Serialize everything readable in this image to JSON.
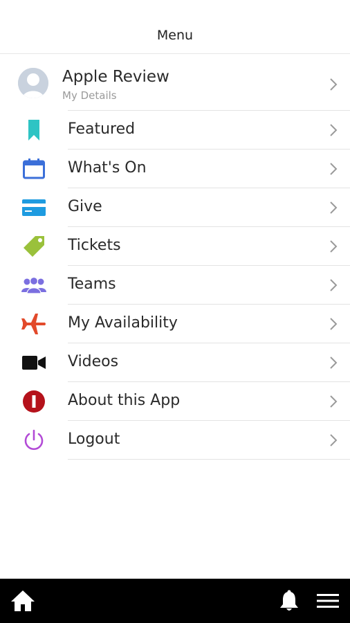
{
  "header": {
    "title": "Menu"
  },
  "profile": {
    "name": "Apple Review",
    "subtitle": "My Details",
    "avatar_icon": "avatar-placeholder-icon"
  },
  "menu": [
    {
      "label": "Featured",
      "icon": "bookmark-icon",
      "color": "#2ec4c4"
    },
    {
      "label": "What's On",
      "icon": "calendar-icon",
      "color": "#3b6fd9"
    },
    {
      "label": "Give",
      "icon": "credit-card-icon",
      "color": "#1e9be0"
    },
    {
      "label": "Tickets",
      "icon": "tag-icon",
      "color": "#9ac13b"
    },
    {
      "label": "Teams",
      "icon": "group-icon",
      "color": "#7b6fe0"
    },
    {
      "label": "My Availability",
      "icon": "airplane-icon",
      "color": "#e24a2b"
    },
    {
      "label": "Videos",
      "icon": "video-camera-icon",
      "color": "#111111"
    },
    {
      "label": "About this App",
      "icon": "info-icon",
      "color": "#b5121b"
    },
    {
      "label": "Logout",
      "icon": "power-icon",
      "color": "#b24ad6"
    }
  ],
  "bottom_bar": {
    "home_icon": "home-icon",
    "bell_icon": "bell-icon",
    "menu_icon": "hamburger-menu-icon"
  }
}
